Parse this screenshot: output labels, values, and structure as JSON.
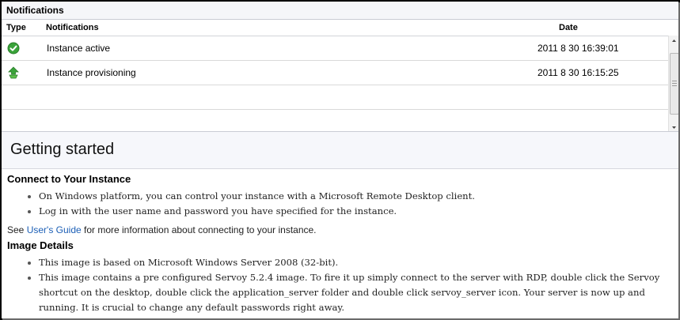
{
  "notifications": {
    "title": "Notifications",
    "columns": {
      "type": "Type",
      "notifications": "Notifications",
      "date": "Date"
    },
    "rows": [
      {
        "icon": "check-circle-icon",
        "text": "Instance active",
        "date": "2011 8 30 16:39:01"
      },
      {
        "icon": "provisioning-arrow-icon",
        "text": "Instance provisioning",
        "date": "2011 8 30 16:15:25"
      }
    ]
  },
  "getting_started": {
    "title": "Getting started",
    "connect": {
      "heading": "Connect to Your Instance",
      "items": [
        "On Windows platform, you can control your instance with a Microsoft Remote Desktop client.",
        "Log in with the user name and password you have specified for the instance."
      ],
      "see_prefix": "See ",
      "see_link": "User's Guide",
      "see_suffix": " for more information about connecting to your instance."
    },
    "image": {
      "heading": "Image Details",
      "items": [
        "This image is based on Microsoft Windows Server 2008 (32-bit).",
        "This image contains a pre configured Servoy 5.2.4 image. To fire it up simply connect to the server with RDP, double click the Servoy shortcut on the desktop, double click the application_server folder and double click servoy_server icon. Your server is now up and running. It is crucial to change any default passwords right away."
      ]
    }
  },
  "colors": {
    "link": "#1c5fb6",
    "success": "#3aa33a"
  }
}
